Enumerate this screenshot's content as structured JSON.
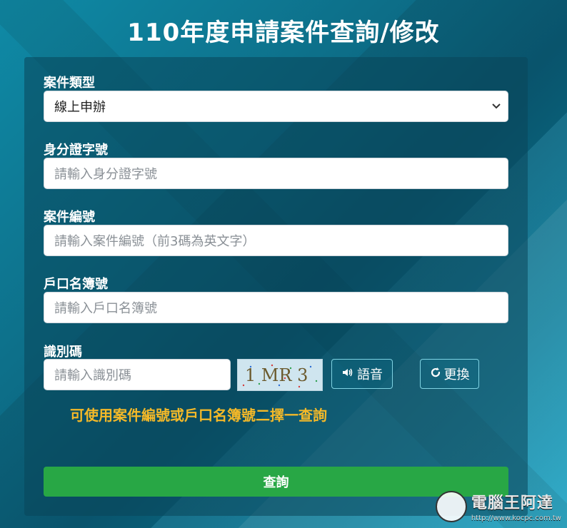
{
  "header": {
    "title": "110年度申請案件查詢/修改"
  },
  "form": {
    "case_type": {
      "label": "案件類型",
      "selected": "線上申辦"
    },
    "id_number": {
      "label": "身分證字號",
      "placeholder": "請輸入身分證字號"
    },
    "case_number": {
      "label": "案件編號",
      "placeholder": "請輸入案件編號（前3碼為英文字）"
    },
    "household_number": {
      "label": "戶口名簿號",
      "placeholder": "請輸入戶口名簿號"
    },
    "captcha": {
      "label": "識別碼",
      "placeholder": "請輸入識別碼",
      "image_text": "1 MR 3",
      "voice_label": "語音",
      "refresh_label": "更換"
    },
    "hint": "可使用案件編號或戶口名簿號二擇一查詢",
    "submit_label": "查詢"
  },
  "watermark": {
    "text": "電腦王阿達",
    "url": "http://www.kocpc.com.tw"
  },
  "colors": {
    "submit": "#28a745",
    "hint": "#f5b928",
    "panel": "#0a4a5a"
  }
}
